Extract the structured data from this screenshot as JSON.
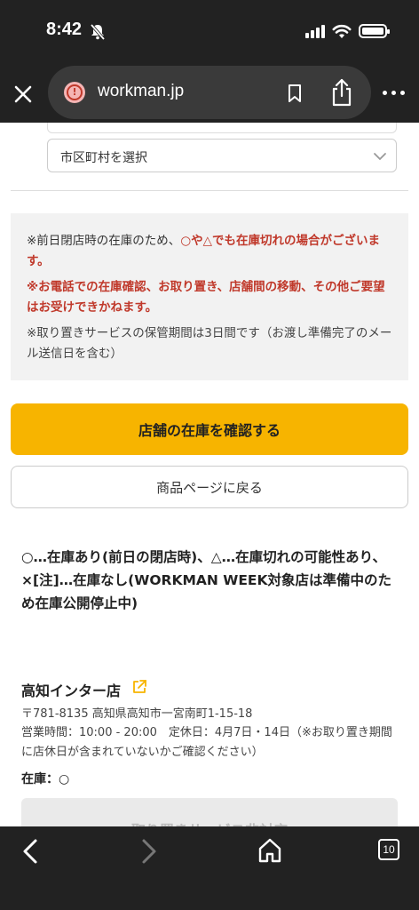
{
  "status_bar": {
    "time": "8:42"
  },
  "browser": {
    "url": "workman.jp",
    "icons": [
      "close-icon",
      "alert-icon",
      "bookmark-icon",
      "share-icon",
      "more-icon"
    ]
  },
  "form": {
    "city_select_placeholder": "市区町村を選択"
  },
  "notices": {
    "n1_prefix": "※前日閉店時の在庫のため、",
    "n1_red": "○や△でも在庫切れの場合がございます。",
    "n2": "※お電話での在庫確認、お取り置き、店舗間の移動、その他ご要望はお受けできかねます。",
    "n3": "※取り置きサービスの保管期間は3日間です（お渡し準備完了のメール送信日を含む）"
  },
  "buttons": {
    "confirm_stock": "店舗の在庫を確認する",
    "back_to_product": "商品ページに戻る"
  },
  "legend": {
    "text": "○…在庫あり(前日の閉店時)、△…在庫切れの可能性あり、×[注]…在庫なし(WORKMAN WEEK対象店は準備中のため在庫公開停止中)"
  },
  "store": {
    "name": "高知インター店",
    "address": "〒781-8135 高知県高知市一宮南町1-15-18",
    "hours": "営業時間：10:00 - 20:00　定休日：4月7日・14日（※お取り置き期間に店休日が含まれていないかご確認ください）",
    "stock_label": "在庫：",
    "stock_value": "○",
    "pickup_button": "取り置きサービス非対応"
  },
  "toolbar": {
    "tab_count": "10"
  },
  "colors": {
    "accent": "#f7b400",
    "alert_red": "#c0392b",
    "chrome_dark": "#222222"
  }
}
